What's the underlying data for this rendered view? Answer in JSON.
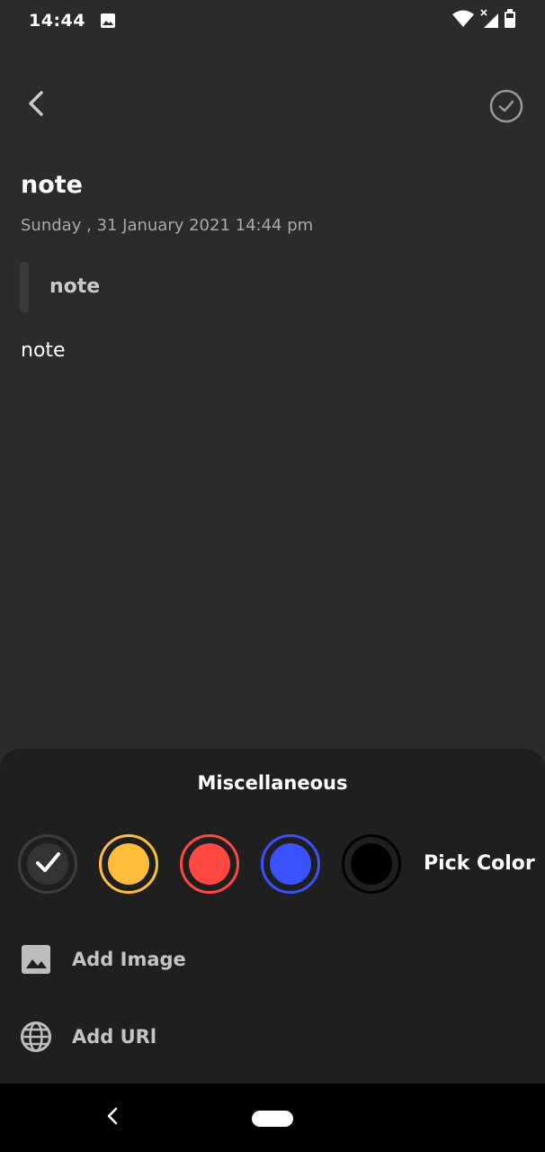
{
  "status_bar": {
    "time": "14:44",
    "icons": [
      "gallery-icon",
      "wifi-icon",
      "signal-icon",
      "battery-icon"
    ]
  },
  "toolbar": {
    "back_icon": "chevron-left-icon",
    "save_icon": "check-circle-icon"
  },
  "note": {
    "title": "note",
    "date": "Sunday , 31 January 2021 14:44 pm",
    "subtitle": "note",
    "body": "note"
  },
  "misc_sheet": {
    "title": "Miscellaneous",
    "colors": [
      {
        "name": "default",
        "color": "#333333",
        "selected": true
      },
      {
        "name": "yellow",
        "color": "#fdbe3b",
        "selected": false
      },
      {
        "name": "red",
        "color": "#ff4842",
        "selected": false
      },
      {
        "name": "blue",
        "color": "#3a52fc",
        "selected": false
      },
      {
        "name": "black",
        "color": "#000000",
        "selected": false
      }
    ],
    "pick_color_label": "Pick Color",
    "add_image_label": "Add Image",
    "add_url_label": "Add URl"
  },
  "theme": {
    "background": "#2b2b2c",
    "sheet_background": "#1f1f20"
  }
}
